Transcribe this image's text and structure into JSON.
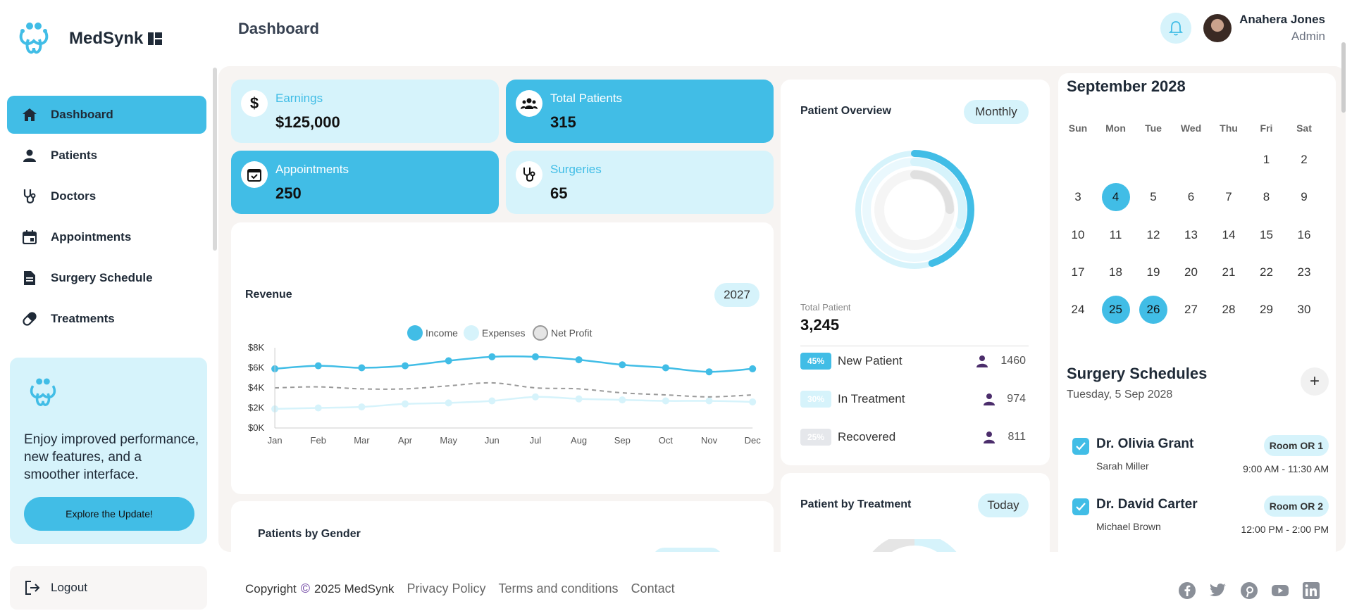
{
  "brand": {
    "name": "MedSynk"
  },
  "header": {
    "title": "Dashboard",
    "user_name": "Anahera Jones",
    "user_role": "Admin"
  },
  "nav": [
    {
      "label": "Dashboard",
      "icon": "home-icon",
      "active": true
    },
    {
      "label": "Patients",
      "icon": "person-icon"
    },
    {
      "label": "Doctors",
      "icon": "stethoscope-icon"
    },
    {
      "label": "Appointments",
      "icon": "calendar-icon"
    },
    {
      "label": "Surgery Schedule",
      "icon": "document-icon"
    },
    {
      "label": "Treatments",
      "icon": "pill-icon"
    }
  ],
  "promo": {
    "text": "Enjoy improved performance, new features, and a smoother interface.",
    "button": "Explore the Update!"
  },
  "logout": "Logout",
  "stats": [
    {
      "label": "Earnings",
      "value": "$125,000",
      "icon": "dollar-icon"
    },
    {
      "label": "Total Patients",
      "value": "315",
      "icon": "group-icon"
    },
    {
      "label": "Appointments",
      "value": "250",
      "icon": "calendar-check-icon"
    },
    {
      "label": "Surgeries",
      "value": "65",
      "icon": "stethoscope-icon"
    }
  ],
  "revenue": {
    "title": "Revenue",
    "year": "2027"
  },
  "chart_data": {
    "type": "line",
    "title": "",
    "categories": [
      "Jan",
      "Feb",
      "Mar",
      "Apr",
      "May",
      "Jun",
      "Jul",
      "Aug",
      "Sep",
      "Oct",
      "Nov",
      "Dec"
    ],
    "series": [
      {
        "name": "Income",
        "values": [
          5900,
          6200,
          6000,
          6200,
          6700,
          7100,
          7100,
          6800,
          6300,
          6000,
          5600,
          5900
        ],
        "color": "#41bde6",
        "style": "solid"
      },
      {
        "name": "Expenses",
        "values": [
          1900,
          2000,
          2100,
          2400,
          2500,
          2700,
          3100,
          2900,
          2800,
          2700,
          2700,
          2600
        ],
        "color": "#d6f3fb",
        "style": "solid"
      },
      {
        "name": "Net Profit",
        "values": [
          4000,
          4100,
          3900,
          3900,
          4200,
          4500,
          4000,
          3900,
          3500,
          3300,
          3100,
          3300
        ],
        "color": "#9a9a9a",
        "style": "dashed"
      }
    ],
    "y_ticks": [
      "$0K",
      "$2K",
      "$4K",
      "$6K",
      "$8K"
    ],
    "ylim": [
      0,
      8000
    ],
    "legend": "top",
    "grid": false
  },
  "gender": {
    "title": "Patients by Gender"
  },
  "overview": {
    "title": "Patient Overview",
    "period": "Monthly",
    "total_label": "Total Patient",
    "total_value": "3,245",
    "rows": [
      {
        "pct": "45%",
        "label": "New Patient",
        "value": "1460",
        "color": "#41bde6"
      },
      {
        "pct": "30%",
        "label": "In Treatment",
        "value": "974",
        "color": "#d6f3fb"
      },
      {
        "pct": "25%",
        "label": "Recovered",
        "value": "811",
        "color": "#e5e7eb"
      }
    ],
    "donut": [
      0.45,
      0.3,
      0.25
    ]
  },
  "treatment": {
    "title": "Patient by Treatment",
    "period": "Today"
  },
  "calendar": {
    "title": "September 2028",
    "days": [
      "Sun",
      "Mon",
      "Tue",
      "Wed",
      "Thu",
      "Fri",
      "Sat"
    ],
    "start_offset": 5,
    "num_days": 30,
    "selected": [
      4,
      25,
      26
    ]
  },
  "surgery": {
    "title": "Surgery Schedules",
    "date": "Tuesday, 5 Sep 2028",
    "items": [
      {
        "doctor": "Dr. Olivia Grant",
        "patient": "Sarah Miller",
        "room": "Room OR 1",
        "time": "9:00 AM - 11:30 AM"
      },
      {
        "doctor": "Dr. David Carter",
        "patient": "Michael Brown",
        "room": "Room OR 2",
        "time": "12:00 PM - 2:00 PM"
      }
    ]
  },
  "footer": {
    "copyright": "Copyright",
    "year_brand": "2025 MedSynk",
    "links": [
      "Privacy Policy",
      "Terms and conditions",
      "Contact"
    ],
    "social": [
      "facebook-icon",
      "twitter-icon",
      "pinterest-icon",
      "youtube-icon",
      "linkedin-icon"
    ]
  }
}
